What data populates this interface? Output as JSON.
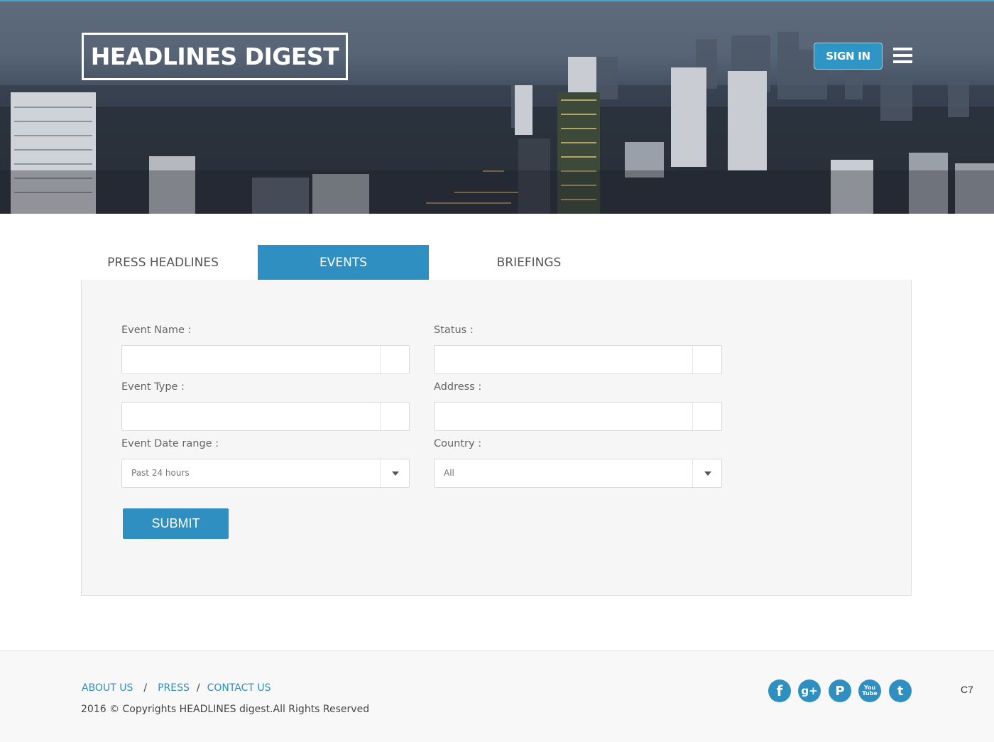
{
  "header": {
    "logo": "HEADLINES DIGEST",
    "signin_label": "SIGN IN",
    "menu_icon": "hamburger-icon"
  },
  "tabs": [
    {
      "label": "PRESS HEADLINES",
      "active": false
    },
    {
      "label": "EVENTS",
      "active": true
    },
    {
      "label": "BRIEFINGS",
      "active": false
    }
  ],
  "form": {
    "event_name": {
      "label": "Event Name :",
      "value": ""
    },
    "status": {
      "label": "Status :",
      "value": ""
    },
    "event_type": {
      "label": "Event Type :",
      "value": ""
    },
    "address": {
      "label": "Address :",
      "value": ""
    },
    "event_date_range": {
      "label": "Event Date range :",
      "selected": "Past 24 hours"
    },
    "country": {
      "label": "Country :",
      "selected": "All"
    },
    "submit_label": "SUBMIT"
  },
  "footer": {
    "links": [
      "ABOUT US",
      "PRESS",
      "CONTACT US"
    ],
    "separator": "/",
    "copyright": "2016 © Copyrights HEADLINES digest.All Rights Reserved",
    "social": [
      {
        "name": "facebook-icon",
        "glyph": "f"
      },
      {
        "name": "google-plus-icon",
        "glyph": "g+"
      },
      {
        "name": "pinterest-icon",
        "glyph": "P"
      },
      {
        "name": "youtube-icon",
        "glyph": "You\nTube"
      },
      {
        "name": "twitter-icon",
        "glyph": "t"
      }
    ],
    "corner_code": "C7"
  },
  "colors": {
    "accent": "#2f8fc0",
    "panel_bg": "#f6f6f6",
    "footer_bg": "#f8f8f8"
  }
}
